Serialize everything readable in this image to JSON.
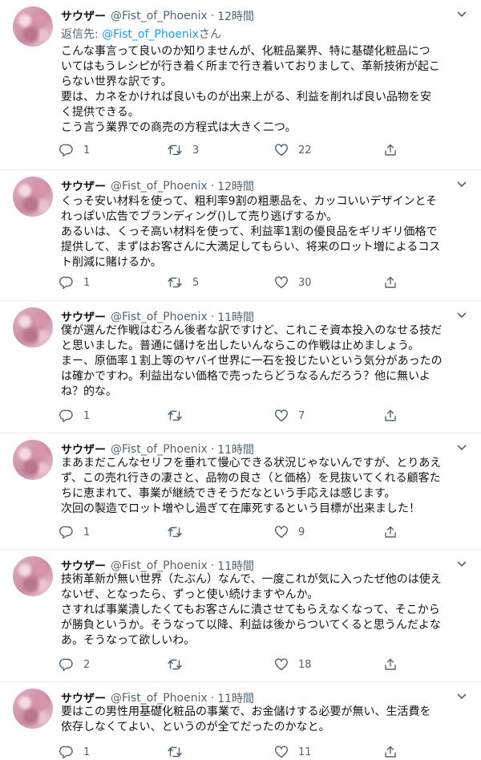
{
  "tweets": [
    {
      "name": "サウザー",
      "handle": "@Fist_of_Phoenix",
      "dot": "·",
      "time": "12時間",
      "reply_prefix": "返信先: ",
      "reply_to": "@Fist_of_Phoenix",
      "reply_suffix": "さん",
      "lines": [
        "こんな事言って良いのか知りませんが、化粧品業界、特に基礎化粧品につ",
        "いてはもうレシピが行き着く所まで行き着いておりまして、革新技術が起こ",
        "らない世界な訳です。",
        "要は、カネをかければ良いものが出来上がる、利益を削れば良い品物を安",
        "く提供できる。",
        "こう言う業界での商売の方程式は大きく二つ。"
      ],
      "replies": "1",
      "retweets": "3",
      "likes": "22"
    },
    {
      "name": "サウザー",
      "handle": "@Fist_of_Phoenix",
      "dot": "·",
      "time": "12時間",
      "lines": [
        "くっそ安い材料を使って、粗利率9割の粗悪品を、カッコいいデザインとそ",
        "れっぽい広告でブランディング()して売り逃げするか。",
        "あるいは、くっそ高い材料を使って、利益率1割の優良品をギリギリ価格で",
        "提供して、まずはお客さんに大満足してもらい、将来のロット増によるコス",
        "ト削減に賭けるか。"
      ],
      "replies": "1",
      "retweets": "5",
      "likes": "30"
    },
    {
      "name": "サウザー",
      "handle": "@Fist_of_Phoenix",
      "dot": "·",
      "time": "11時間",
      "lines": [
        "僕が選んだ作戦はむろん後者な訳ですけど、これこそ資本投入のなせる技だ",
        "と思いました。普通に儲けを出したいんならこの作戦は止めましょう。",
        "まー、原価率１割上等のヤバイ世界に一石を投じたいという気分があったの",
        "は確かですわ。利益出ない価格で売ったらどうなるんだろう？他に無いよ",
        "ね？的な。"
      ],
      "replies": "1",
      "retweets": "",
      "likes": "7"
    },
    {
      "name": "サウザー",
      "handle": "@Fist_of_Phoenix",
      "dot": "·",
      "time": "11時間",
      "lines": [
        "まあまだこんなセリフを垂れて慢心できる状況じゃないんですが、とりあえ",
        "ず、この売れ行きの凄さと、品物の良さ（と価格）を見抜いてくれる顧客た",
        "ちに恵まれて、事業が継続できそうだなという手応えは感じます。",
        "次回の製造でロット増やし過ぎて在庫死するという目標が出来ました！"
      ],
      "replies": "1",
      "retweets": "",
      "likes": "9"
    },
    {
      "name": "サウザー",
      "handle": "@Fist_of_Phoenix",
      "dot": "·",
      "time": "11時間",
      "lines": [
        "技術革新が無い世界（たぶん）なんで、一度これが気に入ったぜ他のは使え",
        "ないぜ、となったら、ずっと使い続けますやんか。",
        "さすれば事業潰したくてもお客さんに潰させてもらえなくなって、そこから",
        "が勝負というか。そうなって以降、利益は後からついてくると思うんだよな",
        "あ。そうなって欲しいわ。"
      ],
      "replies": "2",
      "retweets": "",
      "likes": "18"
    },
    {
      "name": "サウザー",
      "handle": "@Fist_of_Phoenix",
      "dot": "·",
      "time": "11時間",
      "lines": [
        "要はこの男性用基礎化粧品の事業で、お金儲けする必要が無い、生活費を",
        "依存しなくてよい、というのが全てだったのかなと。"
      ],
      "replies": "1",
      "retweets": "",
      "likes": "11"
    }
  ]
}
